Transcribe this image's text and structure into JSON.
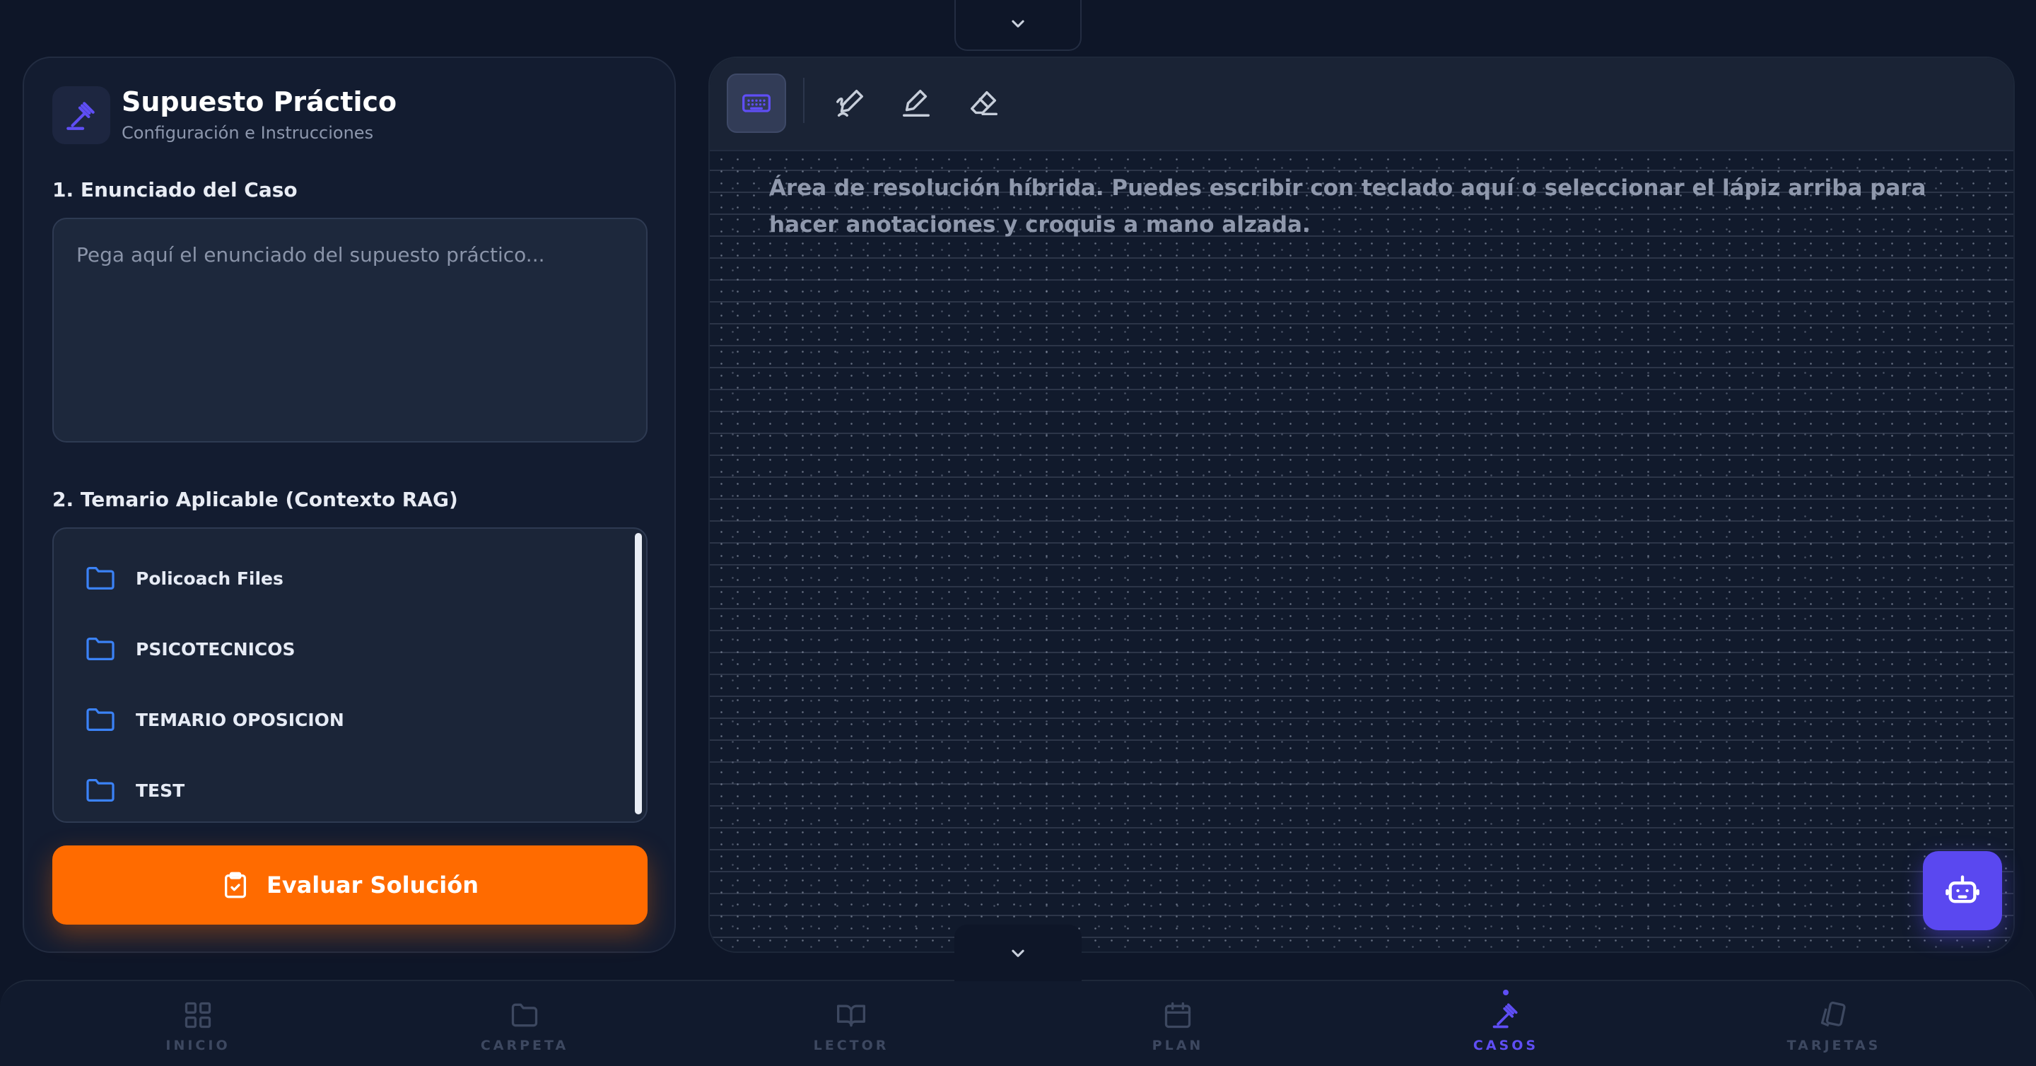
{
  "handles": {
    "top_icon": "chevron-down-icon",
    "bottom_icon": "chevron-down-icon"
  },
  "left_panel": {
    "brand_icon": "gavel-icon",
    "title": "Supuesto Práctico",
    "subtitle": "Configuración e Instrucciones",
    "section1_label": "1. Enunciado del Caso",
    "enunciado_value": "",
    "enunciado_placeholder": "Pega aquí el enunciado del supuesto práctico...",
    "section2_label": "2. Temario Aplicable (Contexto RAG)",
    "folders": [
      {
        "name": "Policoach Files",
        "icon": "folder-icon"
      },
      {
        "name": "PSICOTECNICOS",
        "icon": "folder-icon"
      },
      {
        "name": "TEMARIO OPOSICION",
        "icon": "folder-icon"
      },
      {
        "name": "TEST",
        "icon": "folder-icon"
      }
    ],
    "evaluate_button": {
      "label": "Evaluar Solución",
      "icon": "clipboard-check-icon"
    }
  },
  "editor": {
    "tools": [
      {
        "name": "keyboard",
        "icon": "keyboard-icon",
        "active": true
      },
      {
        "name": "handwriting",
        "icon": "pen-scribble-icon",
        "active": false
      },
      {
        "name": "pen",
        "icon": "pen-icon",
        "active": false
      },
      {
        "name": "eraser",
        "icon": "eraser-icon",
        "active": false
      }
    ],
    "placeholder": "Área de resolución híbrida. Puedes escribir con teclado aquí o seleccionar el lápiz arriba para hacer anotaciones y croquis a mano alzada."
  },
  "assistant_button": {
    "icon": "robot-icon"
  },
  "nav": {
    "items": [
      {
        "label": "INICIO",
        "icon": "grid-icon",
        "active": false
      },
      {
        "label": "CARPETA",
        "icon": "folder-icon",
        "active": false
      },
      {
        "label": "LECTOR",
        "icon": "book-open-icon",
        "active": false
      },
      {
        "label": "PLAN",
        "icon": "calendar-icon",
        "active": false
      },
      {
        "label": "CASOS",
        "icon": "gavel-icon",
        "active": true
      },
      {
        "label": "TARJETAS",
        "icon": "cards-icon",
        "active": false
      }
    ]
  },
  "colors": {
    "background": "#0e1628",
    "panel": "#131c30",
    "accent_orange": "#ff6b00",
    "accent_purple": "#5f4ef5",
    "folder_blue": "#3b82f6"
  }
}
